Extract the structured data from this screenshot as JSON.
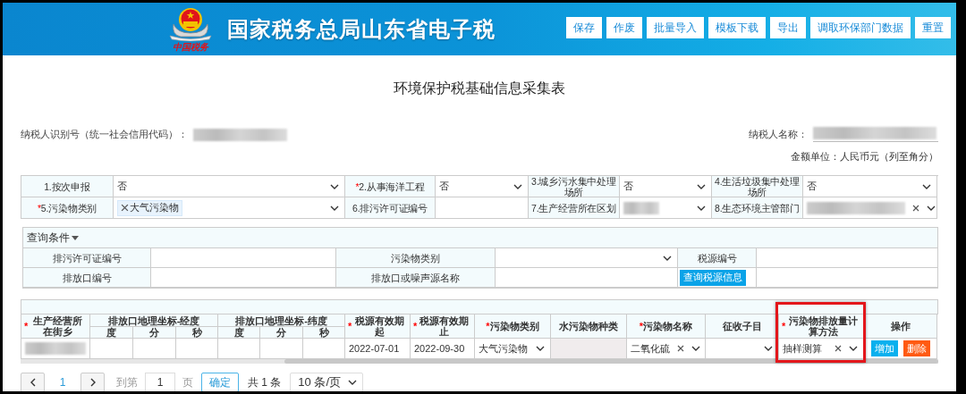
{
  "header": {
    "title": "国家税务总局山东省电子税",
    "logo_caption": "中国税务",
    "buttons": [
      "保存",
      "作废",
      "批量导入",
      "模板下载",
      "导出",
      "调取环保部门数据",
      "重置"
    ]
  },
  "form_title": "环境保护税基础信息采集表",
  "taxpayer": {
    "id_label": "纳税人识别号（统一社会信用代码）：",
    "name_label": "纳税人名称："
  },
  "unit_note": "金额单位：人民币元（列至角分）",
  "basic_fields": [
    {
      "label": {
        "text": "1.按次申报"
      },
      "kind": "select",
      "value": "否",
      "redacted": false,
      "clearable": false
    },
    {
      "label": {
        "mark": "*",
        "text": "2.从事海洋工程"
      },
      "kind": "select",
      "value": "否",
      "redacted": false,
      "clearable": false
    },
    {
      "label": {
        "text": "3.城乡污水集中处理场所"
      },
      "kind": "select",
      "value": "否",
      "redacted": false,
      "clearable": false
    },
    {
      "label": {
        "text": "4.生活垃圾集中处理场所"
      },
      "kind": "select",
      "value": "否",
      "redacted": false,
      "clearable": false
    },
    {
      "label": {
        "mark": "*",
        "text": "5.污染物类别"
      },
      "kind": "tags",
      "tags": [
        "大气污染物"
      ]
    },
    {
      "label": {
        "text": "6.排污许可证编号"
      },
      "kind": "text"
    },
    {
      "label": {
        "text": "7.生产经营所在区划"
      },
      "kind": "select",
      "redacted": true,
      "clearable": false
    },
    {
      "label": {
        "text": "8.生态环境主管部门"
      },
      "kind": "select",
      "redacted": true,
      "clearable": true
    }
  ],
  "query": {
    "title": "查询条件",
    "expanded": true,
    "fields": [
      {
        "kind": "text",
        "label": "排污许可证编号"
      },
      {
        "kind": "select",
        "label": "污染物类别"
      },
      {
        "kind": "text",
        "label": "税源编号"
      },
      {
        "kind": "text",
        "label": "排放口编号"
      },
      {
        "kind": "text",
        "label": "排放口或噪声源名称"
      },
      {
        "kind": "button",
        "label": "查询税源信息"
      }
    ]
  },
  "source_table": {
    "columns": [
      {
        "label": {
          "mark": "*",
          "text": "生产经营所在街乡"
        },
        "highlighted": false
      },
      {
        "label": {
          "text": "排放口地理坐标-经度"
        },
        "subcolumns": [
          "度",
          "分",
          "秒"
        ],
        "highlighted": false
      },
      {
        "label": {
          "text": "排放口地理坐标-纬度"
        },
        "subcolumns": [
          "度",
          "分",
          "秒"
        ],
        "highlighted": false
      },
      {
        "label": {
          "mark": "*",
          "text": "税源有效期起"
        },
        "highlighted": false
      },
      {
        "label": {
          "mark": "*",
          "text": "税源有效期止"
        },
        "highlighted": false
      },
      {
        "label": {
          "mark": "*",
          "text": "污染物类别"
        },
        "highlighted": false
      },
      {
        "label": {
          "text": "水污染物种类"
        },
        "highlighted": false
      },
      {
        "label": {
          "mark": "*",
          "text": "污染物名称"
        },
        "highlighted": false
      },
      {
        "label": {
          "text": "征收子目"
        },
        "highlighted": false
      },
      {
        "label": {
          "mark": "*",
          "text": "污染物排放量计算方法"
        },
        "highlighted": true
      },
      {
        "label": {
          "text": "操作"
        },
        "highlighted": false
      }
    ],
    "rows": [
      {
        "cells": [
          {
            "kind": "redacted"
          },
          {
            "kind": "group",
            "parts": [
              {
                "kind": "blank"
              },
              {
                "kind": "blank"
              },
              {
                "kind": "blank"
              }
            ]
          },
          {
            "kind": "group",
            "parts": [
              {
                "kind": "blank"
              },
              {
                "kind": "blank"
              },
              {
                "kind": "blank"
              }
            ]
          },
          {
            "kind": "text",
            "value": "2022-07-01"
          },
          {
            "kind": "text",
            "value": "2022-09-30"
          },
          {
            "kind": "select",
            "value": "大气污染物",
            "clearable": false
          },
          {
            "kind": "disabled"
          },
          {
            "kind": "select",
            "value": "二氧化硫",
            "clearable": true
          },
          {
            "kind": "select",
            "clearable": false
          },
          {
            "kind": "select",
            "value": "抽样测算",
            "clearable": true
          },
          {
            "kind": "actions",
            "buttons": [
              {
                "kind": "add",
                "label": "增加"
              },
              {
                "kind": "delete",
                "label": "删除"
              }
            ]
          }
        ]
      }
    ]
  },
  "pager": {
    "pages": [
      {
        "label": "1",
        "selected": true
      }
    ],
    "goto_label": "到第",
    "goto_value": "1",
    "page_unit": "页",
    "confirm": "确定",
    "total": "共 1 条",
    "page_size": "10 条/页"
  }
}
